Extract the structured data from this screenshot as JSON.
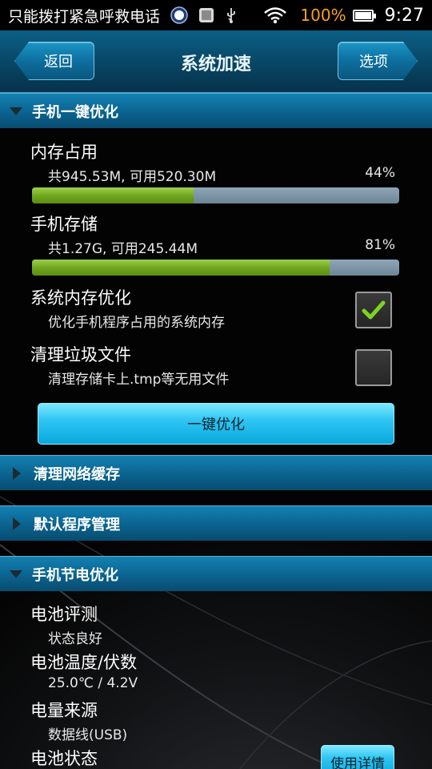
{
  "status_bar": {
    "notification_text": "只能拨打紧急呼救电话",
    "battery_percent": "100%",
    "battery_level": 1.0,
    "time": "9:27",
    "icons": [
      "hundred-badge-icon",
      "image-icon",
      "usb-icon",
      "wifi-icon",
      "battery-icon"
    ]
  },
  "header": {
    "back_label": "返回",
    "title": "系统加速",
    "options_label": "选项"
  },
  "section_one_key": {
    "title": "手机一键优化",
    "memory": {
      "label": "内存占用",
      "detail": "共945.53M, 可用520.30M",
      "percent_text": "44%",
      "percent": 44
    },
    "storage": {
      "label": "手机存储",
      "detail": "共1.27G, 可用245.44M",
      "percent_text": "81%",
      "percent": 81
    },
    "sys_mem_opt": {
      "label": "系统内存优化",
      "detail": "优化手机程序占用的系统内存",
      "checked": true
    },
    "clean_junk": {
      "label": "清理垃圾文件",
      "detail": "清理存储卡上.tmp等无用文件",
      "checked": false
    },
    "optimize_button": "一键优化"
  },
  "section_net_cache": {
    "title": "清理网络缓存"
  },
  "section_default_apps": {
    "title": "默认程序管理"
  },
  "section_power": {
    "title": "手机节电优化",
    "battery_eval": {
      "label": "电池评测",
      "value": "状态良好"
    },
    "battery_temp": {
      "label": "电池温度/伏数",
      "value": "25.0℃ / 4.2V"
    },
    "power_source": {
      "label": "电量来源",
      "value": "数据线(USB)"
    },
    "battery_state": {
      "label": "电池状态"
    },
    "detail_button": "使用详情"
  },
  "colors": {
    "accent_blue": "#0b6592",
    "progress_green": "#6ea31d",
    "battery_orange": "#f7a21a",
    "check_green": "#7ed321"
  }
}
